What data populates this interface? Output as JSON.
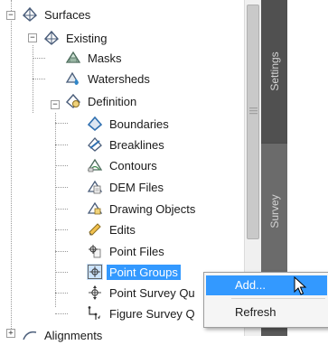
{
  "tree": {
    "surfaces": "Surfaces",
    "existing": "Existing",
    "masks": "Masks",
    "watersheds": "Watersheds",
    "definition": "Definition",
    "boundaries": "Boundaries",
    "breaklines": "Breaklines",
    "contours": "Contours",
    "dem_files": "DEM Files",
    "drawing_objects": "Drawing Objects",
    "edits": "Edits",
    "point_files": "Point Files",
    "point_groups": "Point Groups",
    "point_survey_queries": "Point Survey Qu",
    "figure_survey_queries": "Figure Survey Q",
    "alignments": "Alignments"
  },
  "side_tabs": {
    "settings": "Settings",
    "survey": "Survey"
  },
  "context_menu": {
    "add": "Add...",
    "refresh": "Refresh"
  },
  "colors": {
    "selection": "#3399ff",
    "tab_strip": "#5a5a5a",
    "menu_bg": "#f5f5f5"
  }
}
